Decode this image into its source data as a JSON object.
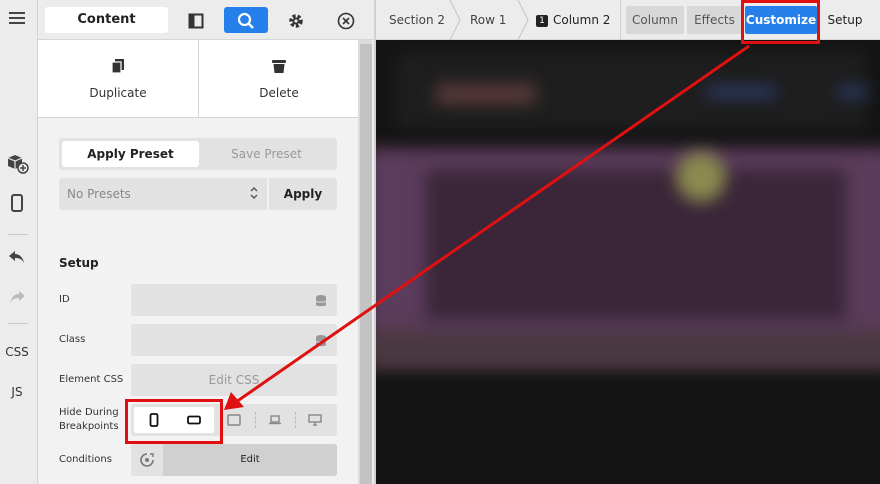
{
  "topbar": {
    "content_tab": "Content"
  },
  "actions": {
    "duplicate": "Duplicate",
    "delete": "Delete"
  },
  "presets": {
    "apply_preset": "Apply Preset",
    "save_preset": "Save Preset",
    "select_value": "No Presets",
    "apply": "Apply"
  },
  "setup": {
    "title": "Setup",
    "id_label": "ID",
    "class_label": "Class",
    "element_css_label": "Element CSS",
    "edit_css": "Edit CSS",
    "hide_label_1": "Hide During",
    "hide_label_2": "Breakpoints",
    "conditions_label": "Conditions",
    "edit": "Edit"
  },
  "rail": {
    "css": "CSS",
    "js": "JS"
  },
  "breadcrumb": {
    "section": "Section 2",
    "row": "Row 1",
    "column_badge": "1",
    "column": "Column 2"
  },
  "tabs": {
    "column": "Column",
    "effects": "Effects",
    "customize": "Customize",
    "setup": "Setup"
  },
  "colors": {
    "accent": "#2680eb",
    "annotation": "#e01010"
  }
}
